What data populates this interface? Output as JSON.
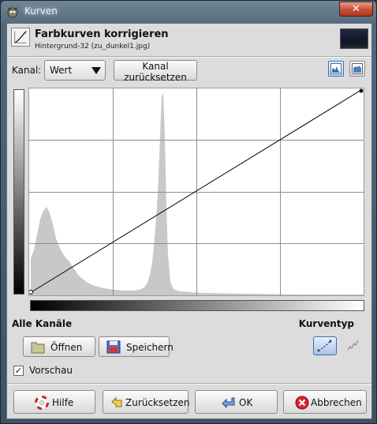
{
  "window": {
    "title": "Kurven",
    "close_label": "✕"
  },
  "header": {
    "title": "Farbkurven korrigieren",
    "subtitle": "Hintergrund-32 (zu_dunkel1.jpg)"
  },
  "channel": {
    "label": "Kanal:",
    "selected": "Wert",
    "reset_label": "Kanal zurücksetzen"
  },
  "histogram_view": {
    "linear_selected": true
  },
  "curve": {
    "points": [
      [
        0,
        0
      ],
      [
        255,
        255
      ]
    ],
    "type": "smooth"
  },
  "sections": {
    "all_channels_label": "Alle Kanäle",
    "curve_type_label": "Kurventyp"
  },
  "buttons": {
    "open": "Öffnen",
    "save": "Speichern",
    "help": "Hilfe",
    "reset": "Zurücksetzen",
    "ok": "OK",
    "cancel": "Abbrechen"
  },
  "preview": {
    "label": "Vorschau",
    "checked": true,
    "check_glyph": "✓"
  },
  "colors": {
    "histogram_fill": "#c8c8c8",
    "grid_line": "#8e8e8e",
    "curve_line": "#000000",
    "selection_blue": "#3d6fa8"
  }
}
